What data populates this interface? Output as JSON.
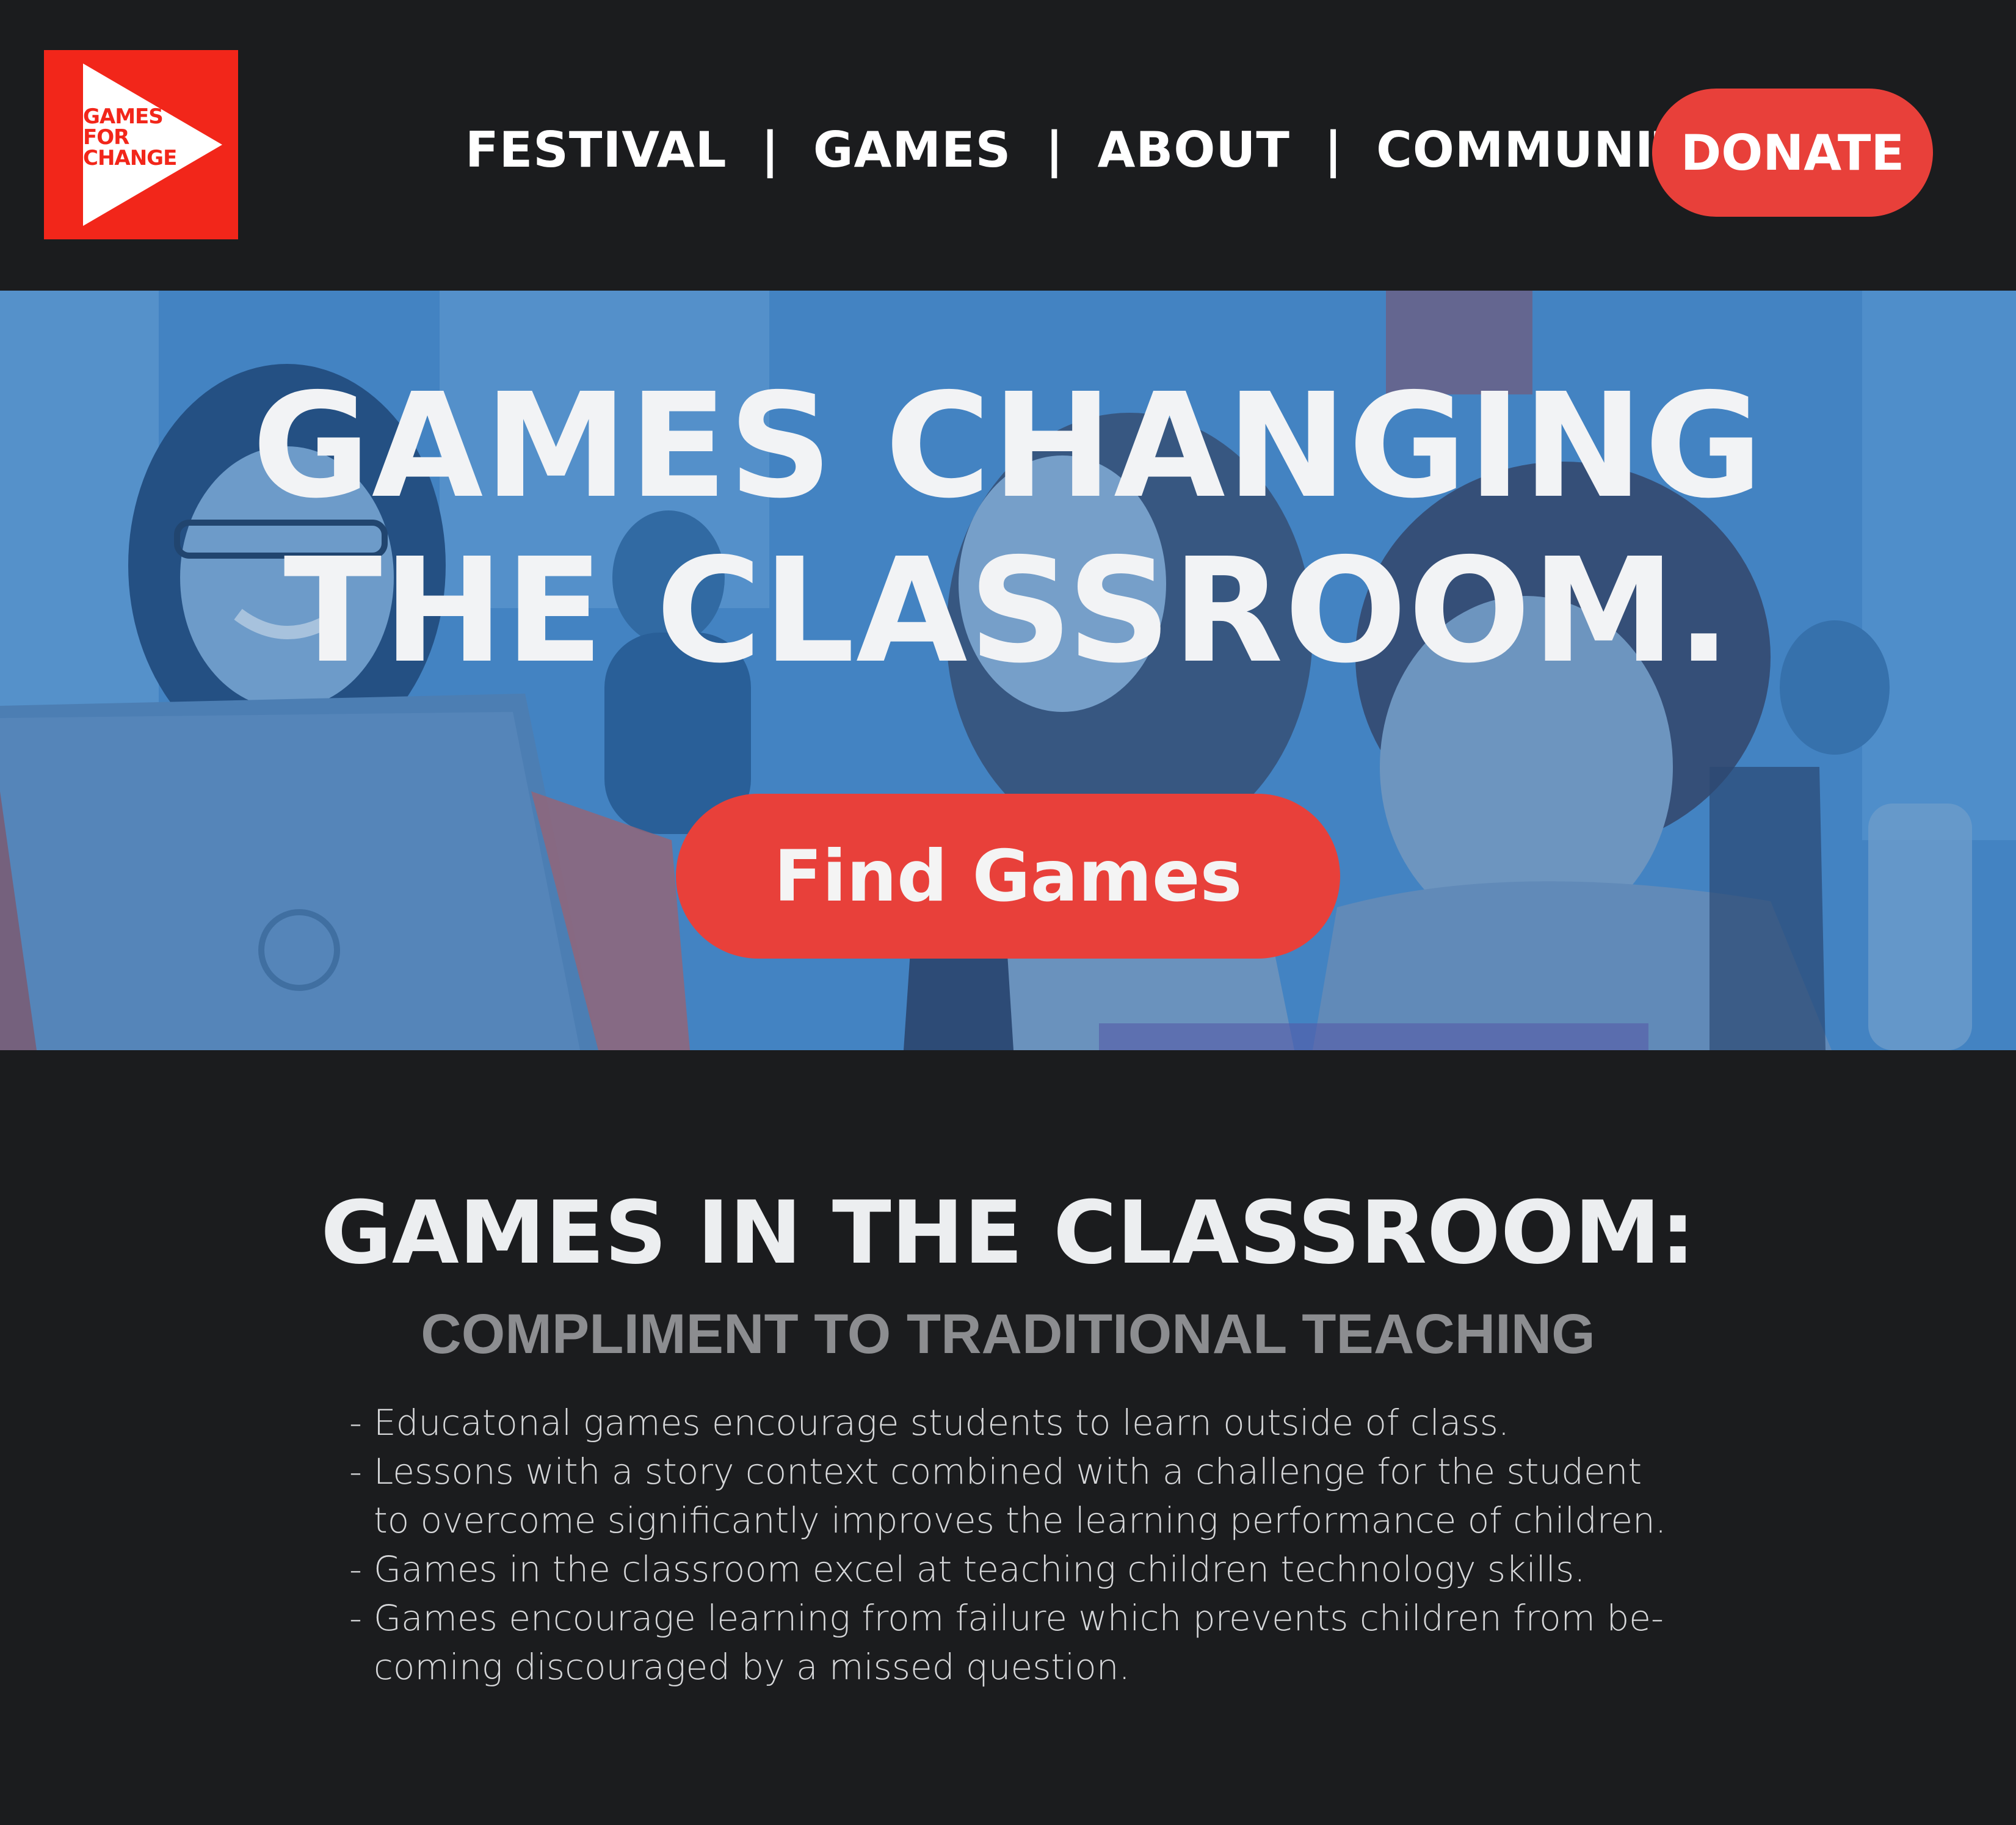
{
  "logo": {
    "lines": [
      "GAMES",
      "FOR",
      "CHANGE"
    ],
    "icon": "play-triangle-icon"
  },
  "nav": {
    "items": [
      {
        "label": "FESTIVAL"
      },
      {
        "label": "GAMES"
      },
      {
        "label": "ABOUT"
      },
      {
        "label": "COMMUNITY"
      }
    ],
    "separator": "|"
  },
  "donate_label": "DONATE",
  "hero": {
    "title_line1": "GAMES CHANGING",
    "title_line2": "THE CLASSROOM.",
    "cta_label": "Find Games"
  },
  "section": {
    "title": "GAMES IN THE CLASSROOM:",
    "subtitle": "COMPLIMENT TO TRADITIONAL TEACHING",
    "bullet_marker": "-",
    "bullets": [
      [
        "Educatonal games encourage students to learn outside of class."
      ],
      [
        "Lessons with a story context combined with a challenge for the student",
        "to overcome significantly improves the learning performance of children."
      ],
      [
        "Games in the classroom excel at teaching children technology skills."
      ],
      [
        "Games encourage learning from failure which prevents children from be-",
        "coming discouraged by a missed question."
      ]
    ]
  },
  "colors": {
    "background": "#1b1c1e",
    "brand_red": "#f2261a",
    "button_red": "#e8403a",
    "hero_blue": "#3c78b8",
    "subtitle_gray": "#8c8d90"
  }
}
